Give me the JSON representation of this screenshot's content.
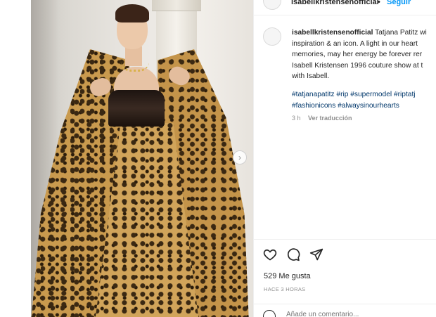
{
  "post": {
    "username": "isabellkristensenofficial",
    "separator": "•",
    "follow_label": "Seguir"
  },
  "caption": {
    "username": "isabellkristensenofficial",
    "lines": [
      "Tatjana Patitz wi",
      "inspiration & an icon. A light in our heart",
      "memories, may her energy be forever rer",
      "Isabell Kristensen 1996 couture show at t",
      "with Isabell."
    ],
    "hashtag_lines": [
      "#tatjanapatitz #rip #supermodel #riptatj",
      "#fashionicons #alwaysinourhearts"
    ],
    "time": "3 h",
    "translate_label": "Ver traducción"
  },
  "actions": {
    "likes": "529 Me gusta",
    "posted_ago": "HACE 3 HORAS"
  },
  "comment": {
    "placeholder": "Añade un comentario..."
  },
  "icons": {
    "like": "heart-icon",
    "comment": "comment-icon",
    "share": "paper-plane-icon",
    "next": "chevron-right-icon",
    "emoji": "smiley-icon"
  },
  "colors": {
    "link": "#0095f6",
    "hashtag": "#00376b",
    "muted": "#8e8e8e",
    "text": "#262626"
  }
}
